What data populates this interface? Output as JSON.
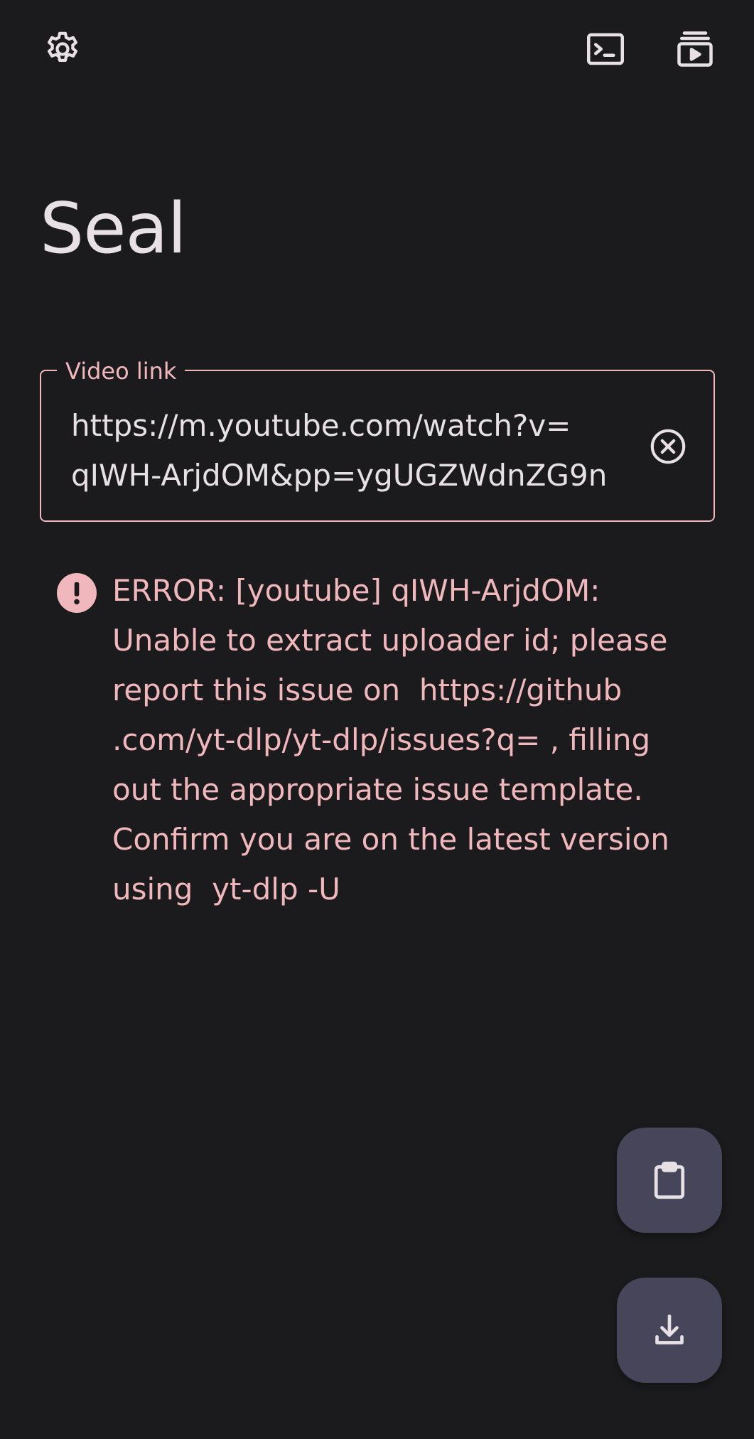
{
  "colors": {
    "background": "#1b1b1d",
    "on_surface": "#e7e1e5",
    "error_pink": "#f0b8bd",
    "fab_container": "#46455a"
  },
  "top_bar": {
    "settings_icon": "gear-icon",
    "terminal_icon": "terminal-icon",
    "queue_icon": "video-queue-icon"
  },
  "app": {
    "title": "Seal"
  },
  "video_link_field": {
    "label": "Video link",
    "value_lines": [
      "https://m.youtube.com/watch?v=",
      "qIWH-ArjdOM&pp=ygUGZWdnZG9n"
    ],
    "clear_icon": "clear-circle-icon"
  },
  "error": {
    "icon": "error-icon",
    "lines": [
      "ERROR: [youtube] qIWH-ArjdOM:",
      "Unable to extract uploader id; please",
      "report this issue on  https://github",
      ".com/yt-dlp/yt-dlp/issues?q= , filling",
      "out the appropriate issue template.",
      "Confirm you are on the latest version",
      "using  yt-dlp -U"
    ]
  },
  "fabs": {
    "paste_icon": "clipboard-icon",
    "download_icon": "download-icon"
  }
}
